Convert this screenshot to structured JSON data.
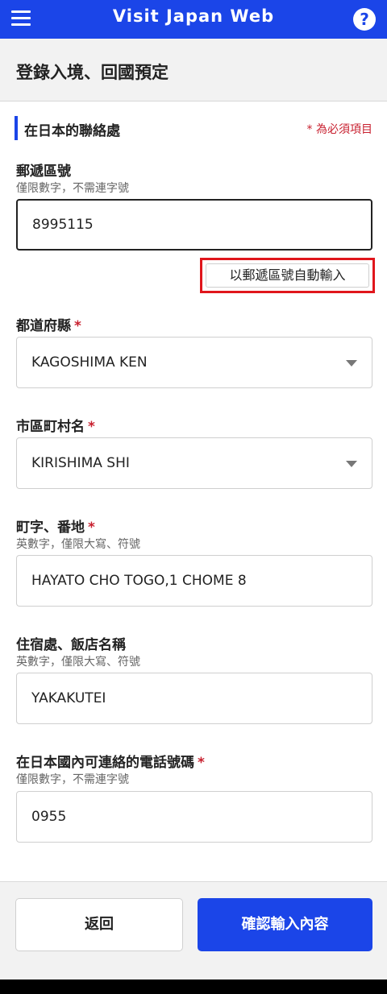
{
  "app": {
    "title": "Visit Japan Web",
    "help_glyph": "?",
    "page_title": "登錄入境、回國預定"
  },
  "section": {
    "title": "在日本的聯絡處",
    "required_note": "* 為必須項目"
  },
  "form": {
    "postal": {
      "label": "郵遞區號",
      "hint": "僅限數字，不需連字號",
      "value": "8995115",
      "auto_button_label": "以郵遞區號自動輸入"
    },
    "prefecture": {
      "label": "都道府縣",
      "required_mark": "*",
      "value": "KAGOSHIMA KEN"
    },
    "city": {
      "label": "市區町村名",
      "required_mark": "*",
      "value": "KIRISHIMA SHI"
    },
    "address": {
      "label": "町字、番地",
      "required_mark": "*",
      "hint": "英數字，僅限大寫、符號",
      "value": "HAYATO CHO TOGO,1 CHOME 8"
    },
    "lodging": {
      "label": "住宿處、飯店名稱",
      "hint": "英數字，僅限大寫、符號",
      "value": "YAKAKUTEI"
    },
    "phone": {
      "label": "在日本國內可連絡的電話號碼",
      "required_mark": "*",
      "hint": "僅限數字，不需連字號",
      "value": "0955"
    }
  },
  "footer": {
    "back_label": "返回",
    "confirm_label": "確認輸入內容"
  },
  "colors": {
    "brand_blue": "#1b45e8",
    "required_red": "#c8202f",
    "highlight_red": "#e0161c"
  }
}
